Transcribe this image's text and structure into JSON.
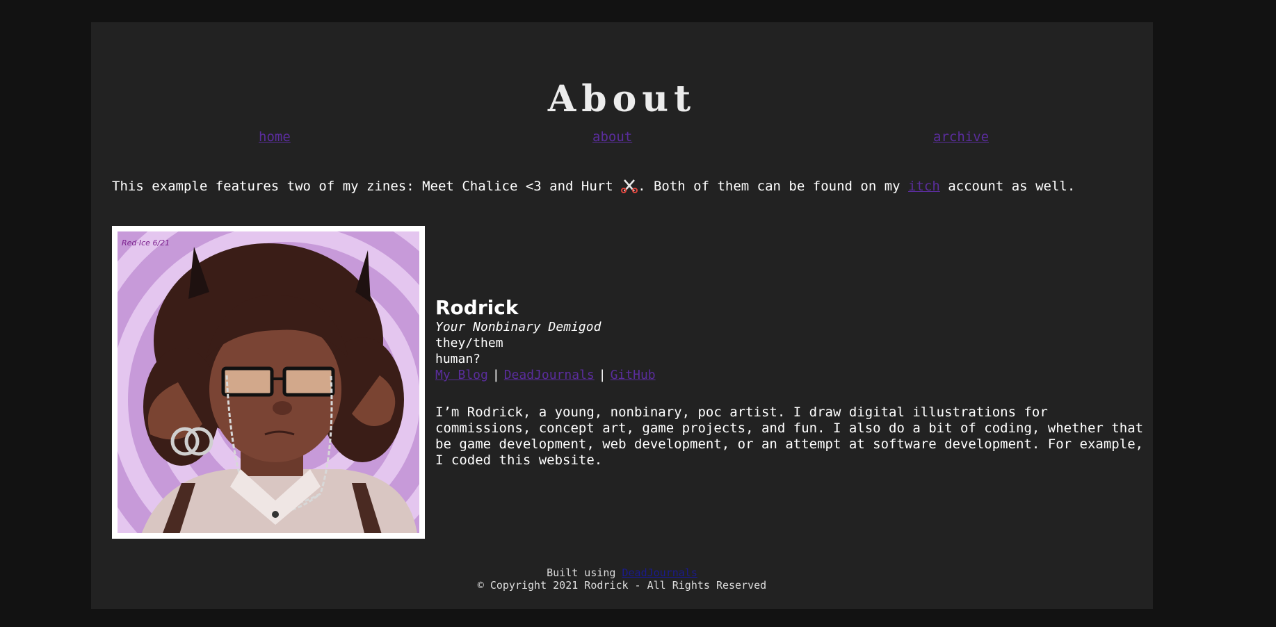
{
  "page": {
    "title": "About"
  },
  "nav": {
    "home": "home",
    "about": "about",
    "archive": "archive"
  },
  "intro": {
    "text_before": "This example features two of my zines: Meet Chalice <3 and Hurt ",
    "text_middle": ". Both of them can be found on my ",
    "link": "itch",
    "text_after": " account as well."
  },
  "profile": {
    "name": "Rodrick",
    "tagline": "Your Nonbinary Demigod",
    "pronouns": "they/them",
    "species": "human?",
    "links": {
      "blog": "My Blog",
      "deadjournals": "DeadJournals",
      "github": "GitHub"
    },
    "separator": "|",
    "bio": "I’m Rodrick, a young, nonbinary, poc artist. I draw digital illustrations for commissions, concept art, game projects, and fun. I also do a bit of coding, whether that be game development, web development, or an attempt at software development. For example, I coded this website."
  },
  "footer": {
    "built_prefix": "Built using ",
    "built_link": "DeadJournals",
    "copyright": "© Copyright 2021 Rodrick - All Rights Reserved"
  },
  "colors": {
    "link": "#5a2d9c",
    "panel": "#222222",
    "background": "#121212"
  }
}
